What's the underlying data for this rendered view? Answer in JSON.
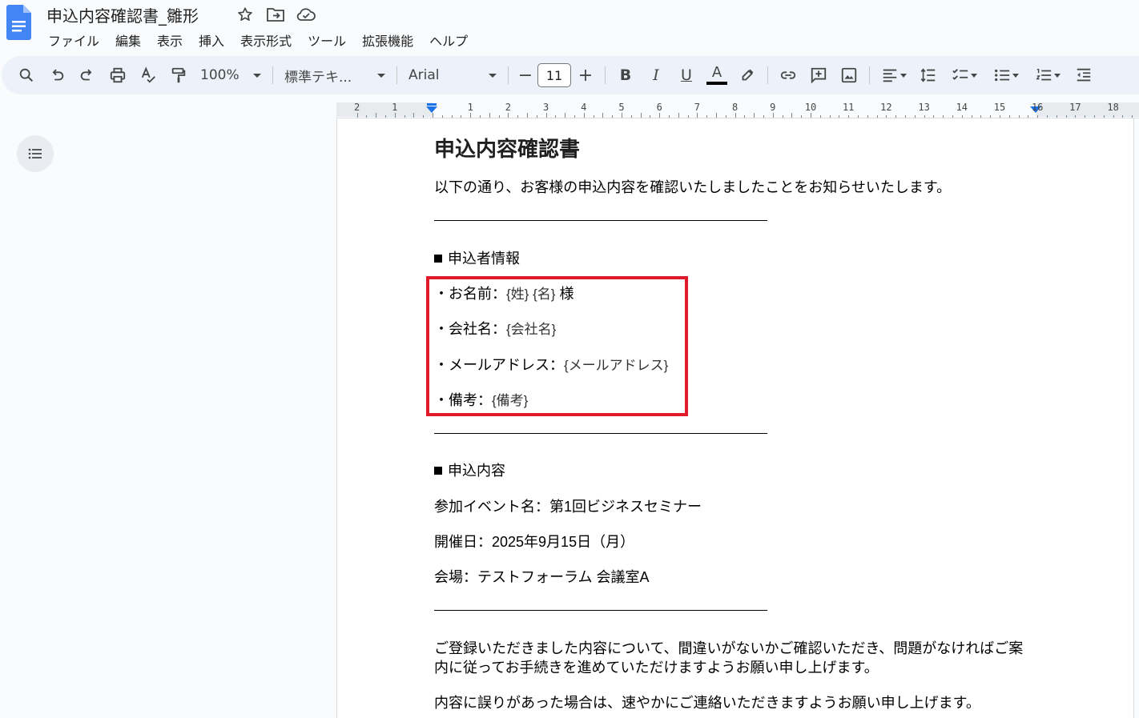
{
  "doc": {
    "title": "申込内容確認書_雛形"
  },
  "menu": {
    "items": [
      "ファイル",
      "編集",
      "表示",
      "挿入",
      "表示形式",
      "ツール",
      "拡張機能",
      "ヘルプ"
    ]
  },
  "toolbar": {
    "zoom": "100%",
    "style": "標準テキ...",
    "font": "Arial",
    "font_size": "11",
    "minus": "−",
    "plus": "+",
    "bold": "B",
    "italic": "I",
    "underline": "U",
    "text_color_letter": "A",
    "text_color": "#000000"
  },
  "ruler": {
    "numbers": [
      "2",
      "1",
      "1",
      "2",
      "3",
      "4",
      "5",
      "6",
      "7",
      "8",
      "9",
      "10",
      "11",
      "12",
      "13",
      "14",
      "15",
      "16",
      "17",
      "18"
    ]
  },
  "content": {
    "heading": "申込内容確認書",
    "intro": "以下の通り、お客様の申込内容を確認いたしましたことをお知らせいたします。",
    "section1_title": "申込者情報",
    "name_label": "・お名前：",
    "name_value": "{姓} {名}",
    "name_suffix": " 様",
    "company_label": "・会社名：",
    "company_value": "{会社名}",
    "email_label": "・メールアドレス：",
    "email_value": "{メールアドレス}",
    "notes_label": "・備考：",
    "notes_value": "{備考}",
    "section2_title": "申込内容",
    "event": "参加イベント名：第1回ビジネスセミナー",
    "date": "開催日：2025年9月15日（月）",
    "venue": "会場：テストフォーラム 会議室A",
    "closing1_line1": "ご登録いただきました内容について、間違いがないかご確認いただき、問題がなければご案",
    "closing1_line2": "内に従ってお手続きを進めていただけますようお願い申し上げます。",
    "closing2": "内容に誤りがあった場合は、速やかにご連絡いただきますようお願い申し上げます。"
  },
  "colors": {
    "highlight_border": "#e01a2b",
    "docs_blue": "#4285f4",
    "ruler_marker": "#1a73e8"
  }
}
